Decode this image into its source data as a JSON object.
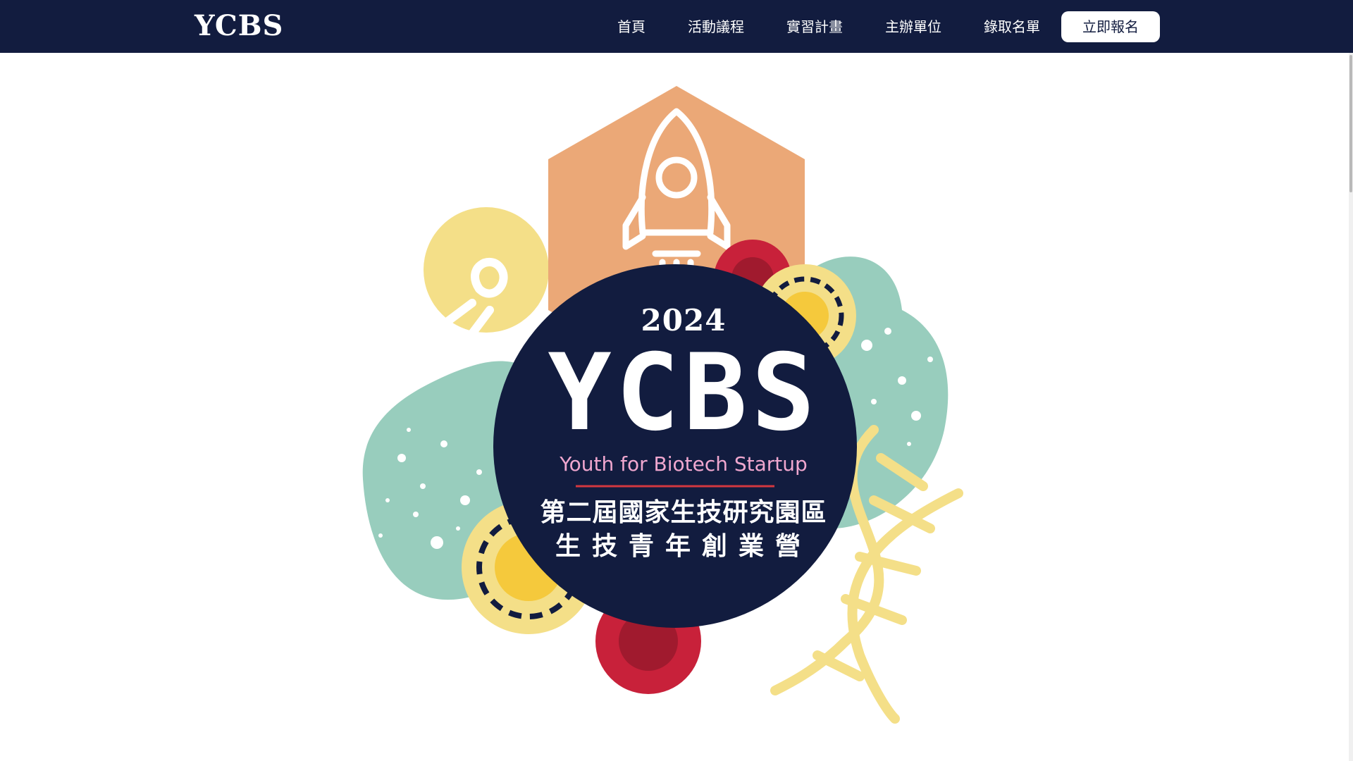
{
  "header": {
    "brand": "YCBS",
    "nav_items": [
      {
        "label": "首頁"
      },
      {
        "label": "活動議程"
      },
      {
        "label": "實習計畫"
      },
      {
        "label": "主辦單位"
      },
      {
        "label": "錄取名單"
      }
    ],
    "cta_label": "立即報名"
  },
  "hero": {
    "logo": {
      "year": "2024",
      "mark": "YCBS",
      "tagline": "Youth for Biotech Startup",
      "title_line1": "第二屆國家生技研究園區",
      "title_line2": "生技青年創業營"
    },
    "decorations": {
      "icons": [
        "rocket-icon",
        "lightbulb-icon",
        "gear-icon",
        "dna-icon"
      ]
    }
  },
  "colors": {
    "navbar_bg": "#121c3f",
    "circle_bg": "#121c3f",
    "hexagon": "#eba877",
    "teal_blob": "#98cdbd",
    "yellow": "#f4df88",
    "gear_yellow": "#f5c93c",
    "gear_red": "#c8213a",
    "tagline_pink": "#f0a7cf",
    "divider_red": "#d2373f"
  }
}
